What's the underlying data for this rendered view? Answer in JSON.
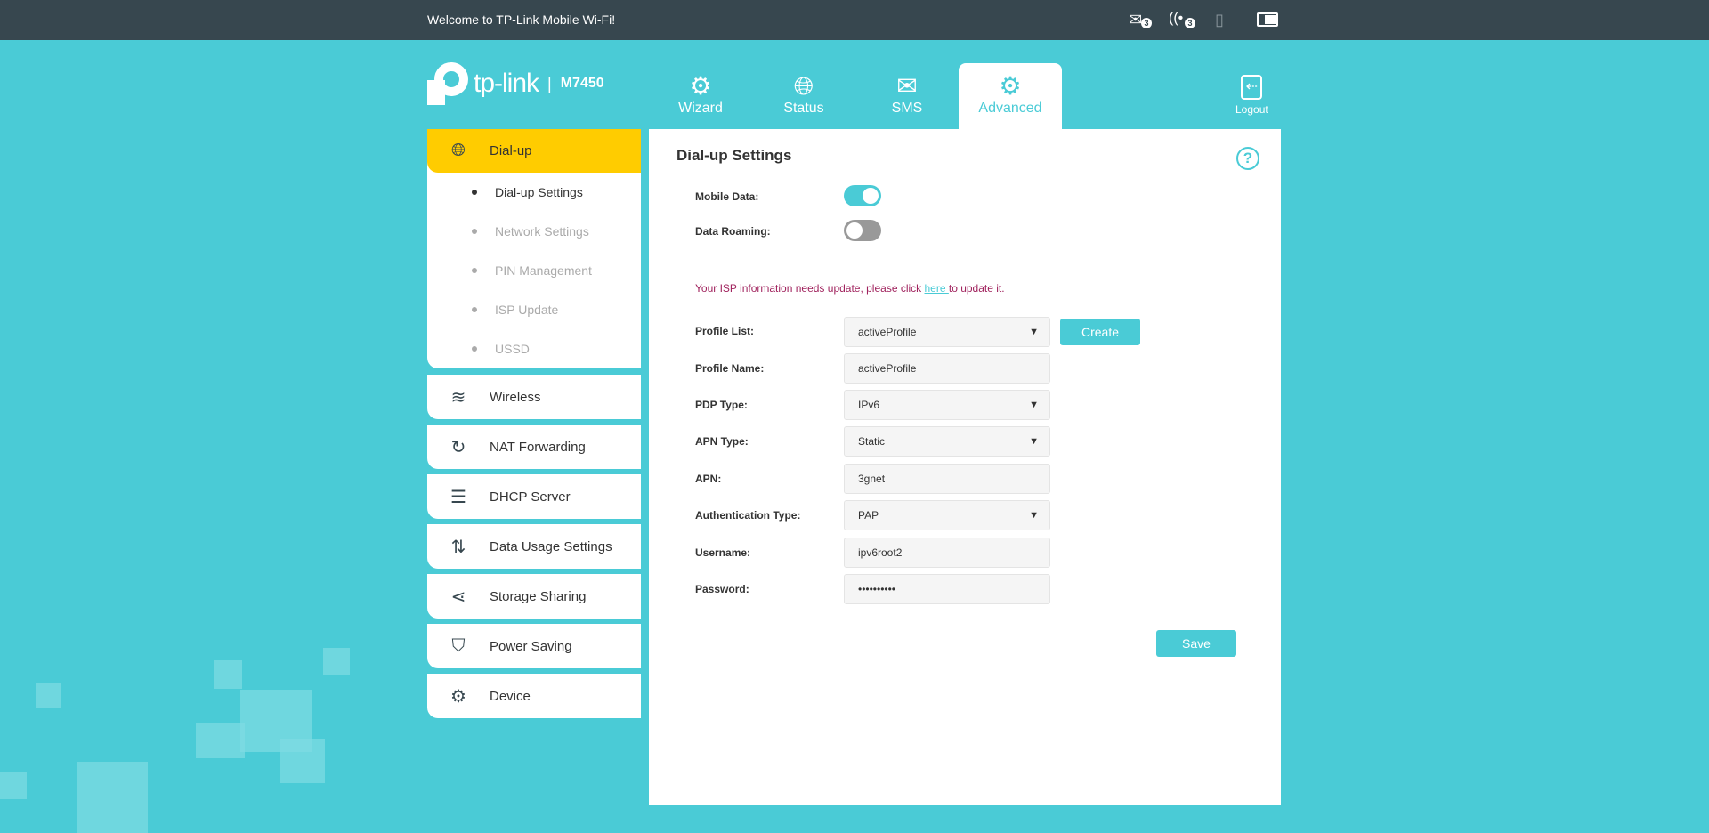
{
  "topbar": {
    "welcome": "Welcome to TP-Link Mobile Wi-Fi!",
    "sms_count": "3",
    "wifi_clients": "3",
    "icons": [
      "envelope-icon",
      "wifi-icon",
      "sim-card-missing-icon",
      "battery-icon"
    ]
  },
  "logo": {
    "brand": "tp-link",
    "model": "M7450"
  },
  "tabs": [
    {
      "label": "Wizard",
      "icon": "gear-icon"
    },
    {
      "label": "Status",
      "icon": "globe-icon"
    },
    {
      "label": "SMS",
      "icon": "envelope-icon"
    },
    {
      "label": "Advanced",
      "icon": "gears-icon",
      "active": true
    }
  ],
  "logout": "Logout",
  "sidebar": {
    "head": "Dial-up",
    "sub": [
      "Dial-up Settings",
      "Network Settings",
      "PIN Management",
      "ISP Update",
      "USSD"
    ],
    "items": [
      {
        "label": "Wireless",
        "icon": "wifi-icon"
      },
      {
        "label": "NAT Forwarding",
        "icon": "refresh-icon"
      },
      {
        "label": "DHCP Server",
        "icon": "server-icon"
      },
      {
        "label": "Data Usage Settings",
        "icon": "up-down-arrows-icon"
      },
      {
        "label": "Storage Sharing",
        "icon": "share-icon"
      },
      {
        "label": "Power Saving",
        "icon": "shield-bolt-icon"
      },
      {
        "label": "Device",
        "icon": "gear-icon"
      }
    ]
  },
  "panel": {
    "title": "Dial-up Settings",
    "help": "?",
    "mobile_data": {
      "label": "Mobile Data:",
      "on": true
    },
    "data_roaming": {
      "label": "Data Roaming:",
      "on": false
    },
    "msg": {
      "before": "Your ISP information needs update, please click ",
      "link": "here ",
      "after": "to update it."
    },
    "fields": [
      {
        "label": "Profile List:",
        "value": "activeProfile",
        "select": true
      },
      {
        "label": "Profile Name:",
        "value": "activeProfile"
      },
      {
        "label": "PDP Type:",
        "value": "IPv6",
        "select": true
      },
      {
        "label": "APN Type:",
        "value": "Static",
        "select": true
      },
      {
        "label": "APN:",
        "value": "3gnet"
      },
      {
        "label": "Authentication Type:",
        "value": "PAP",
        "select": true
      },
      {
        "label": "Username:",
        "value": "ipv6root2"
      },
      {
        "label": "Password:",
        "value": "••••••••••"
      }
    ],
    "create": "Create",
    "save": "Save"
  },
  "colors": {
    "accent": "#4acbd6",
    "topbar": "#37474f",
    "active": "#ffcc00",
    "warning": "#a0225d"
  }
}
